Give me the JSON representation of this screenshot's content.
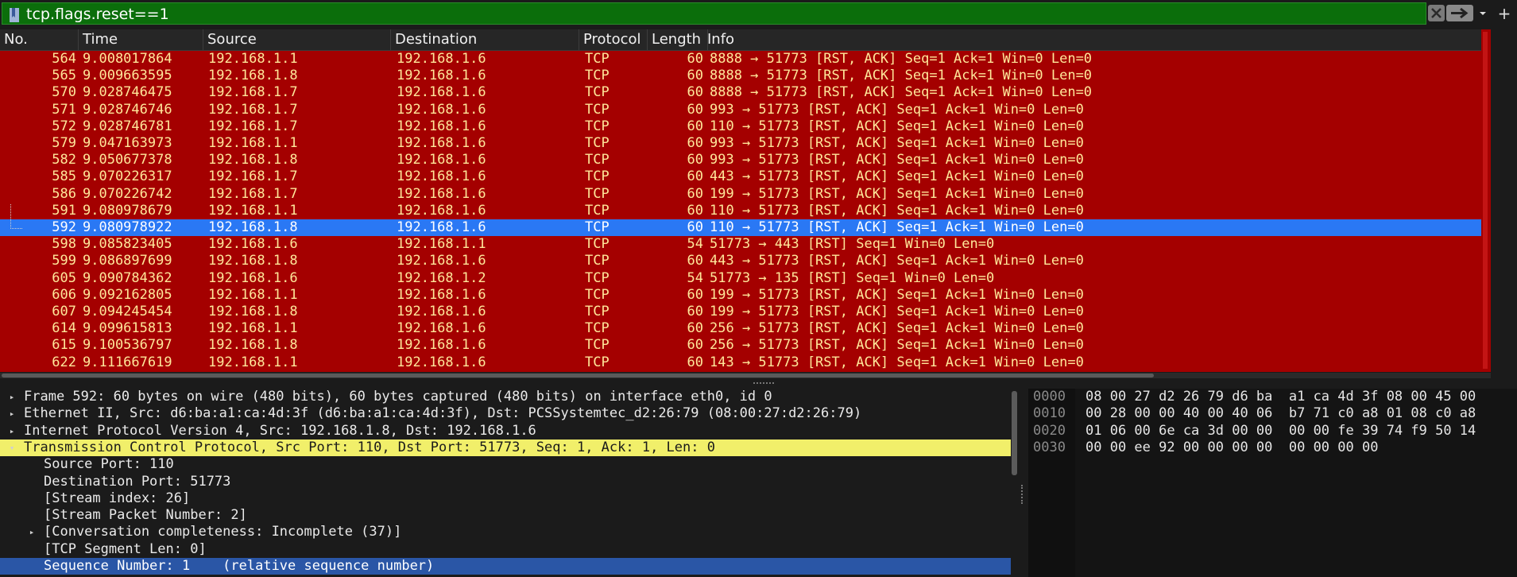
{
  "filter": {
    "value": "tcp.flags.reset==1",
    "bookmark_icon": "bookmark-icon",
    "clear_icon": "clear-icon",
    "apply_icon": "arrow-right-icon",
    "dropdown_icon": "chevron-down-icon",
    "add_label": "+",
    "bg_color": "#0b6e0b"
  },
  "columns": [
    "No.",
    "Time",
    "Source",
    "Destination",
    "Protocol",
    "Length",
    "Info"
  ],
  "rows": [
    {
      "no": "564",
      "time": "9.008017864",
      "src": "192.168.1.1",
      "dst": "192.168.1.6",
      "proto": "TCP",
      "len": "60",
      "info": "8888 → 51773 [RST, ACK] Seq=1 Ack=1 Win=0 Len=0"
    },
    {
      "no": "565",
      "time": "9.009663595",
      "src": "192.168.1.8",
      "dst": "192.168.1.6",
      "proto": "TCP",
      "len": "60",
      "info": "8888 → 51773 [RST, ACK] Seq=1 Ack=1 Win=0 Len=0"
    },
    {
      "no": "570",
      "time": "9.028746475",
      "src": "192.168.1.7",
      "dst": "192.168.1.6",
      "proto": "TCP",
      "len": "60",
      "info": "8888 → 51773 [RST, ACK] Seq=1 Ack=1 Win=0 Len=0"
    },
    {
      "no": "571",
      "time": "9.028746746",
      "src": "192.168.1.7",
      "dst": "192.168.1.6",
      "proto": "TCP",
      "len": "60",
      "info": "993 → 51773 [RST, ACK] Seq=1 Ack=1 Win=0 Len=0"
    },
    {
      "no": "572",
      "time": "9.028746781",
      "src": "192.168.1.7",
      "dst": "192.168.1.6",
      "proto": "TCP",
      "len": "60",
      "info": "110 → 51773 [RST, ACK] Seq=1 Ack=1 Win=0 Len=0"
    },
    {
      "no": "579",
      "time": "9.047163973",
      "src": "192.168.1.1",
      "dst": "192.168.1.6",
      "proto": "TCP",
      "len": "60",
      "info": "993 → 51773 [RST, ACK] Seq=1 Ack=1 Win=0 Len=0"
    },
    {
      "no": "582",
      "time": "9.050677378",
      "src": "192.168.1.8",
      "dst": "192.168.1.6",
      "proto": "TCP",
      "len": "60",
      "info": "993 → 51773 [RST, ACK] Seq=1 Ack=1 Win=0 Len=0"
    },
    {
      "no": "585",
      "time": "9.070226317",
      "src": "192.168.1.7",
      "dst": "192.168.1.6",
      "proto": "TCP",
      "len": "60",
      "info": "443 → 51773 [RST, ACK] Seq=1 Ack=1 Win=0 Len=0"
    },
    {
      "no": "586",
      "time": "9.070226742",
      "src": "192.168.1.7",
      "dst": "192.168.1.6",
      "proto": "TCP",
      "len": "60",
      "info": "199 → 51773 [RST, ACK] Seq=1 Ack=1 Win=0 Len=0"
    },
    {
      "no": "591",
      "time": "9.080978679",
      "src": "192.168.1.1",
      "dst": "192.168.1.6",
      "proto": "TCP",
      "len": "60",
      "info": "110 → 51773 [RST, ACK] Seq=1 Ack=1 Win=0 Len=0"
    },
    {
      "no": "592",
      "time": "9.080978922",
      "src": "192.168.1.8",
      "dst": "192.168.1.6",
      "proto": "TCP",
      "len": "60",
      "info": "110 → 51773 [RST, ACK] Seq=1 Ack=1 Win=0 Len=0"
    },
    {
      "no": "598",
      "time": "9.085823405",
      "src": "192.168.1.6",
      "dst": "192.168.1.1",
      "proto": "TCP",
      "len": "54",
      "info": "51773 → 443 [RST] Seq=1 Win=0 Len=0"
    },
    {
      "no": "599",
      "time": "9.086897699",
      "src": "192.168.1.8",
      "dst": "192.168.1.6",
      "proto": "TCP",
      "len": "60",
      "info": "443 → 51773 [RST, ACK] Seq=1 Ack=1 Win=0 Len=0"
    },
    {
      "no": "605",
      "time": "9.090784362",
      "src": "192.168.1.6",
      "dst": "192.168.1.2",
      "proto": "TCP",
      "len": "54",
      "info": "51773 → 135 [RST] Seq=1 Win=0 Len=0"
    },
    {
      "no": "606",
      "time": "9.092162805",
      "src": "192.168.1.1",
      "dst": "192.168.1.6",
      "proto": "TCP",
      "len": "60",
      "info": "199 → 51773 [RST, ACK] Seq=1 Ack=1 Win=0 Len=0"
    },
    {
      "no": "607",
      "time": "9.094245454",
      "src": "192.168.1.8",
      "dst": "192.168.1.6",
      "proto": "TCP",
      "len": "60",
      "info": "199 → 51773 [RST, ACK] Seq=1 Ack=1 Win=0 Len=0"
    },
    {
      "no": "614",
      "time": "9.099615813",
      "src": "192.168.1.1",
      "dst": "192.168.1.6",
      "proto": "TCP",
      "len": "60",
      "info": "256 → 51773 [RST, ACK] Seq=1 Ack=1 Win=0 Len=0"
    },
    {
      "no": "615",
      "time": "9.100536797",
      "src": "192.168.1.8",
      "dst": "192.168.1.6",
      "proto": "TCP",
      "len": "60",
      "info": "256 → 51773 [RST, ACK] Seq=1 Ack=1 Win=0 Len=0"
    },
    {
      "no": "622",
      "time": "9.111667619",
      "src": "192.168.1.1",
      "dst": "192.168.1.6",
      "proto": "TCP",
      "len": "60",
      "info": "143 → 51773 [RST, ACK] Seq=1 Ack=1 Win=0 Len=0"
    }
  ],
  "selected_row_no": "592",
  "row_colors": {
    "bg": "#a40000",
    "fg": "#ffe79a",
    "selected_bg": "#2a78f4"
  },
  "details": [
    {
      "arrow": "collapsed",
      "indent": 0,
      "text": "Frame 592: 60 bytes on wire (480 bits), 60 bytes captured (480 bits) on interface eth0, id 0"
    },
    {
      "arrow": "collapsed",
      "indent": 0,
      "text": "Ethernet II, Src: d6:ba:a1:ca:4d:3f (d6:ba:a1:ca:4d:3f), Dst: PCSSystemtec_d2:26:79 (08:00:27:d2:26:79)"
    },
    {
      "arrow": "collapsed",
      "indent": 0,
      "text": "Internet Protocol Version 4, Src: 192.168.1.8, Dst: 192.168.1.6"
    },
    {
      "arrow": "expanded",
      "indent": 0,
      "text": "Transmission Control Protocol, Src Port: 110, Dst Port: 51773, Seq: 1, Ack: 1, Len: 0",
      "style": "highlight"
    },
    {
      "arrow": "none",
      "indent": 1,
      "text": "Source Port: 110"
    },
    {
      "arrow": "none",
      "indent": 1,
      "text": "Destination Port: 51773"
    },
    {
      "arrow": "none",
      "indent": 1,
      "text": "[Stream index: 26]"
    },
    {
      "arrow": "none",
      "indent": 1,
      "text": "[Stream Packet Number: 2]"
    },
    {
      "arrow": "collapsed",
      "indent": 1,
      "text": "[Conversation completeness: Incomplete (37)]"
    },
    {
      "arrow": "none",
      "indent": 1,
      "text": "[TCP Segment Len: 0]"
    },
    {
      "arrow": "none",
      "indent": 1,
      "text": "Sequence Number: 1    (relative sequence number)",
      "style": "selected"
    }
  ],
  "bytes": [
    {
      "offset": "0000",
      "hex": "08 00 27 d2 26 79 d6 ba  a1 ca 4d 3f 08 00 45 00"
    },
    {
      "offset": "0010",
      "hex": "00 28 00 00 40 00 40 06  b7 71 c0 a8 01 08 c0 a8"
    },
    {
      "offset": "0020",
      "hex": "01 06 00 6e ca 3d 00 00  00 00 fe 39 74 f9 50 14"
    },
    {
      "offset": "0030",
      "hex": "00 00 ee 92 00 00 00 00  00 00 00 00"
    }
  ]
}
